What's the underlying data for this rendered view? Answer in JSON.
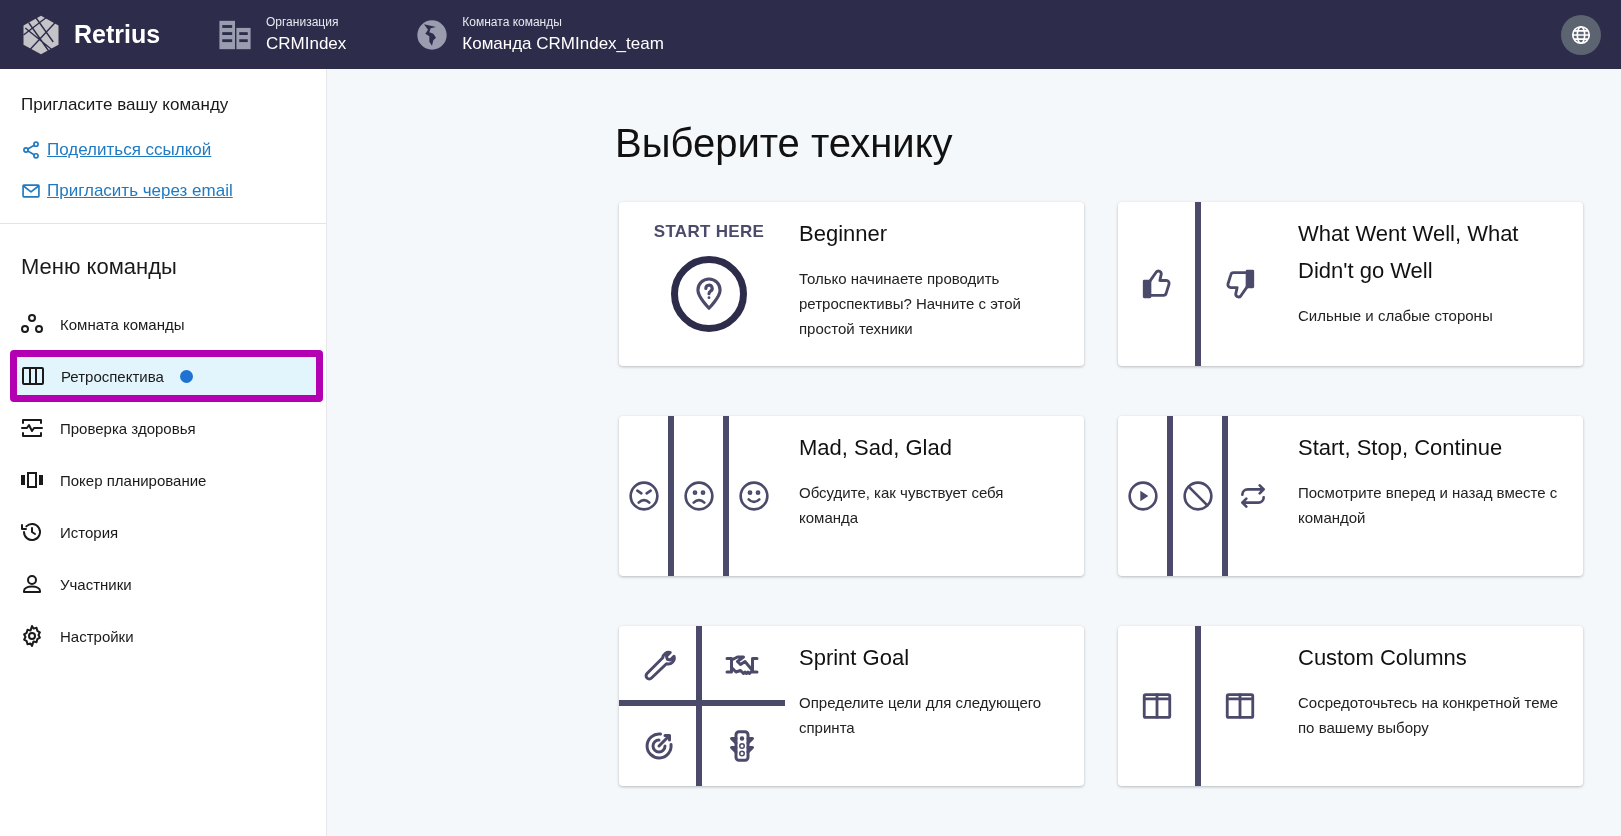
{
  "header": {
    "logo": "Retrius",
    "organization": {
      "label": "Организация",
      "value": "CRMIndex"
    },
    "room": {
      "label": "Комната команды",
      "value": "Команда CRMIndex_team"
    }
  },
  "sidebar": {
    "invite_title": "Пригласите вашу команду",
    "invite_links": [
      "Поделиться ссылкой",
      "Пригласить через email"
    ],
    "menu_title": "Меню команды",
    "items": [
      {
        "label": "Комната команды",
        "selected": false,
        "highlighted": false,
        "dot": false
      },
      {
        "label": "Ретроспектива",
        "selected": true,
        "highlighted": true,
        "dot": true
      },
      {
        "label": "Проверка здоровья",
        "selected": false,
        "highlighted": false,
        "dot": false
      },
      {
        "label": "Покер планирование",
        "selected": false,
        "highlighted": false,
        "dot": false
      },
      {
        "label": "История",
        "selected": false,
        "highlighted": false,
        "dot": false
      },
      {
        "label": "Участники",
        "selected": false,
        "highlighted": false,
        "dot": false
      },
      {
        "label": "Настройки",
        "selected": false,
        "highlighted": false,
        "dot": false
      }
    ]
  },
  "main": {
    "title": "Выберите технику",
    "techniques": [
      {
        "kind": "beginner",
        "tag": "START HERE",
        "title": "Beginner",
        "description": "Только начинаете проводить ретроспективы? Начните с этой простой техники"
      },
      {
        "kind": "columns",
        "title": "What Went Well, What Didn't go Well",
        "description": "Сильные и слабые стороны"
      },
      {
        "kind": "columns",
        "title": "Mad, Sad, Glad",
        "description": "Обсудите, как чувствует себя команда"
      },
      {
        "kind": "columns",
        "title": "Start, Stop, Continue",
        "description": "Посмотрите вперед и назад вместе с командой"
      },
      {
        "kind": "grid",
        "title": "Sprint Goal",
        "description": "Определите цели для следующего спринта"
      },
      {
        "kind": "columns",
        "title": "Custom Columns",
        "description": "Сосредоточьтесь на конкретной теме по вашему выбору"
      }
    ]
  }
}
